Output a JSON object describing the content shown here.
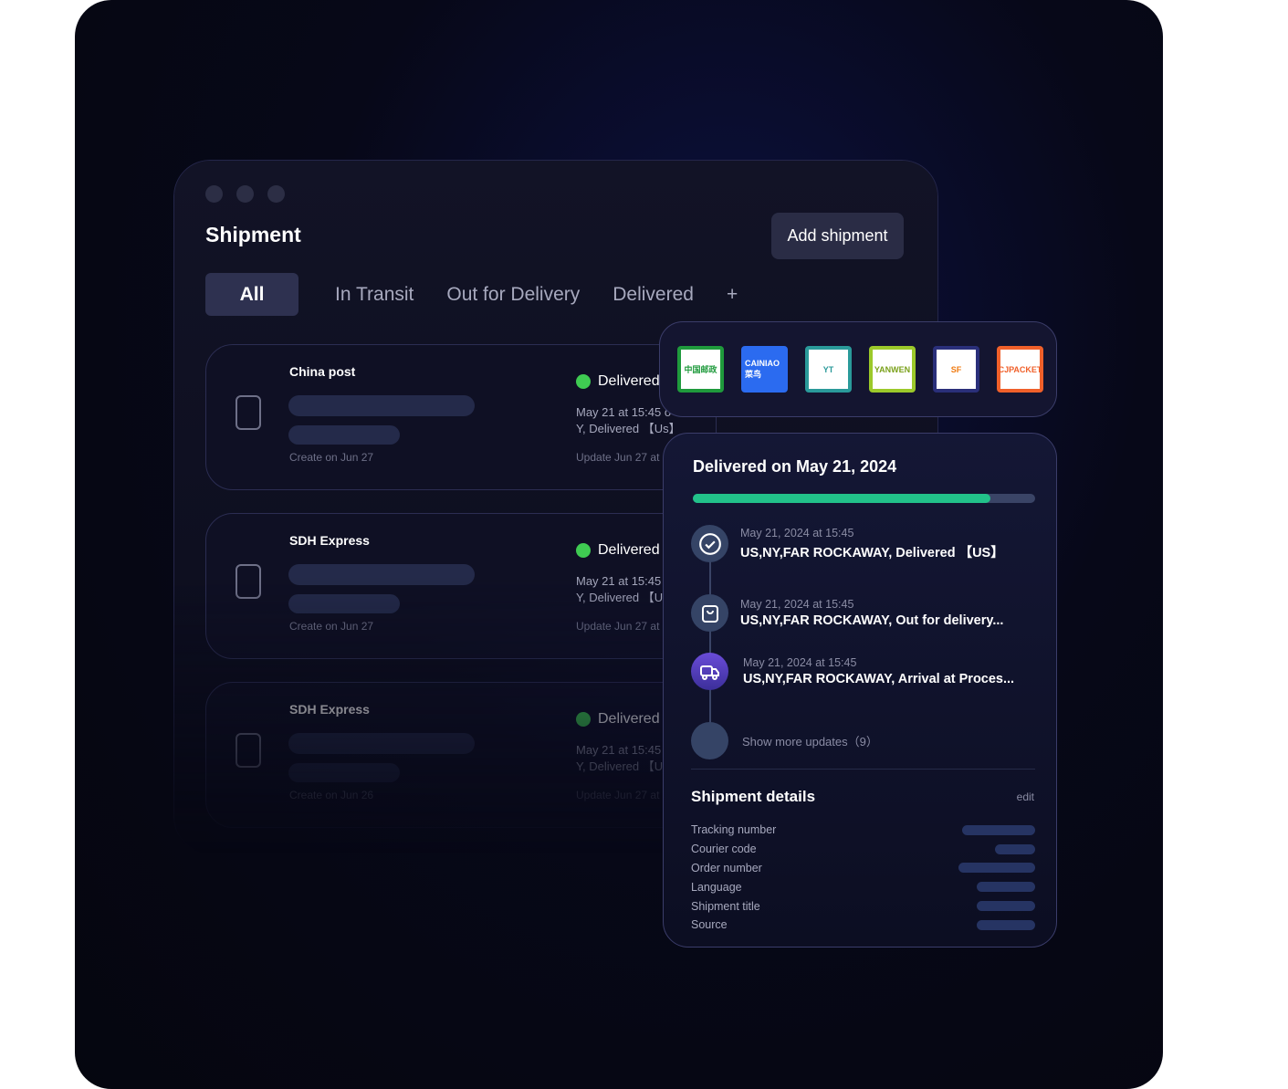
{
  "window": {
    "title": "Shipment",
    "add_button": "Add shipment"
  },
  "tabs": [
    {
      "label": "All",
      "active": true
    },
    {
      "label": "In Transit"
    },
    {
      "label": "Out for Delivery"
    },
    {
      "label": "Delivered"
    },
    {
      "label": "+"
    }
  ],
  "shipments": [
    {
      "courier": "China post",
      "created": "Create on Jun 27",
      "status": "Delivered",
      "event_line1": "May 21 at 15:45 o",
      "event_line2": "Y, Delivered 【Us】",
      "updated": "Update Jun 27 at"
    },
    {
      "courier": "SDH Express",
      "created": "Create on Jun 27",
      "status": "Delivered",
      "event_line1": "May 21 at 15:45",
      "event_line2": "Y, Delivered 【U",
      "updated": "Update Jun 27 at"
    },
    {
      "courier": "SDH Express",
      "created": "Create on Jun 26",
      "status": "Delivered",
      "event_line1": "May 21 at 15:45",
      "event_line2": "Y, Delivered 【U",
      "updated": "Update Jun 27 at"
    }
  ],
  "status_color": "#3fcb52",
  "couriers": [
    {
      "name": "中国邮政",
      "border": "#1f9a3c",
      "bg": "#ffffff",
      "fg": "#1f9a3c"
    },
    {
      "name": "CAINIAO 菜鸟",
      "border": "#2b6bf0",
      "bg": "#2b6bf0",
      "fg": "#ffffff"
    },
    {
      "name": "YT",
      "border": "#2a9a9a",
      "bg": "#ffffff",
      "fg": "#2a9a9a"
    },
    {
      "name": "YANWEN",
      "border": "#9cc92a",
      "bg": "#ffffff",
      "fg": "#7aa01a"
    },
    {
      "name": "SF",
      "border": "#2a2f7a",
      "bg": "#ffffff",
      "fg": "#f07a10"
    },
    {
      "name": "CJPACKET",
      "border": "#f0602a",
      "bg": "#ffffff",
      "fg": "#f0602a"
    }
  ],
  "detail": {
    "title": "Delivered on May 21, 2024",
    "progress_percent": 87,
    "progress_color": "#22c28a",
    "events": [
      {
        "icon": "check-circle",
        "date": "May 21, 2024 at 15:45",
        "text": "US,NY,FAR ROCKAWAY,  Delivered  【US】"
      },
      {
        "icon": "shopping-bag",
        "date": "May 21, 2024 at 15:45",
        "text": "US,NY,FAR ROCKAWAY, Out for delivery..."
      },
      {
        "icon": "truck",
        "date": "May 21, 2024 at 15:45",
        "text": "US,NY,FAR ROCKAWAY, Arrival at Proces..."
      }
    ],
    "show_more": "Show more updates（9）",
    "details_title": "Shipment details",
    "edit": "edit",
    "fields": [
      "Tracking number",
      "Courier code",
      "Order number",
      "Language",
      "Shipment title",
      "Source"
    ]
  }
}
